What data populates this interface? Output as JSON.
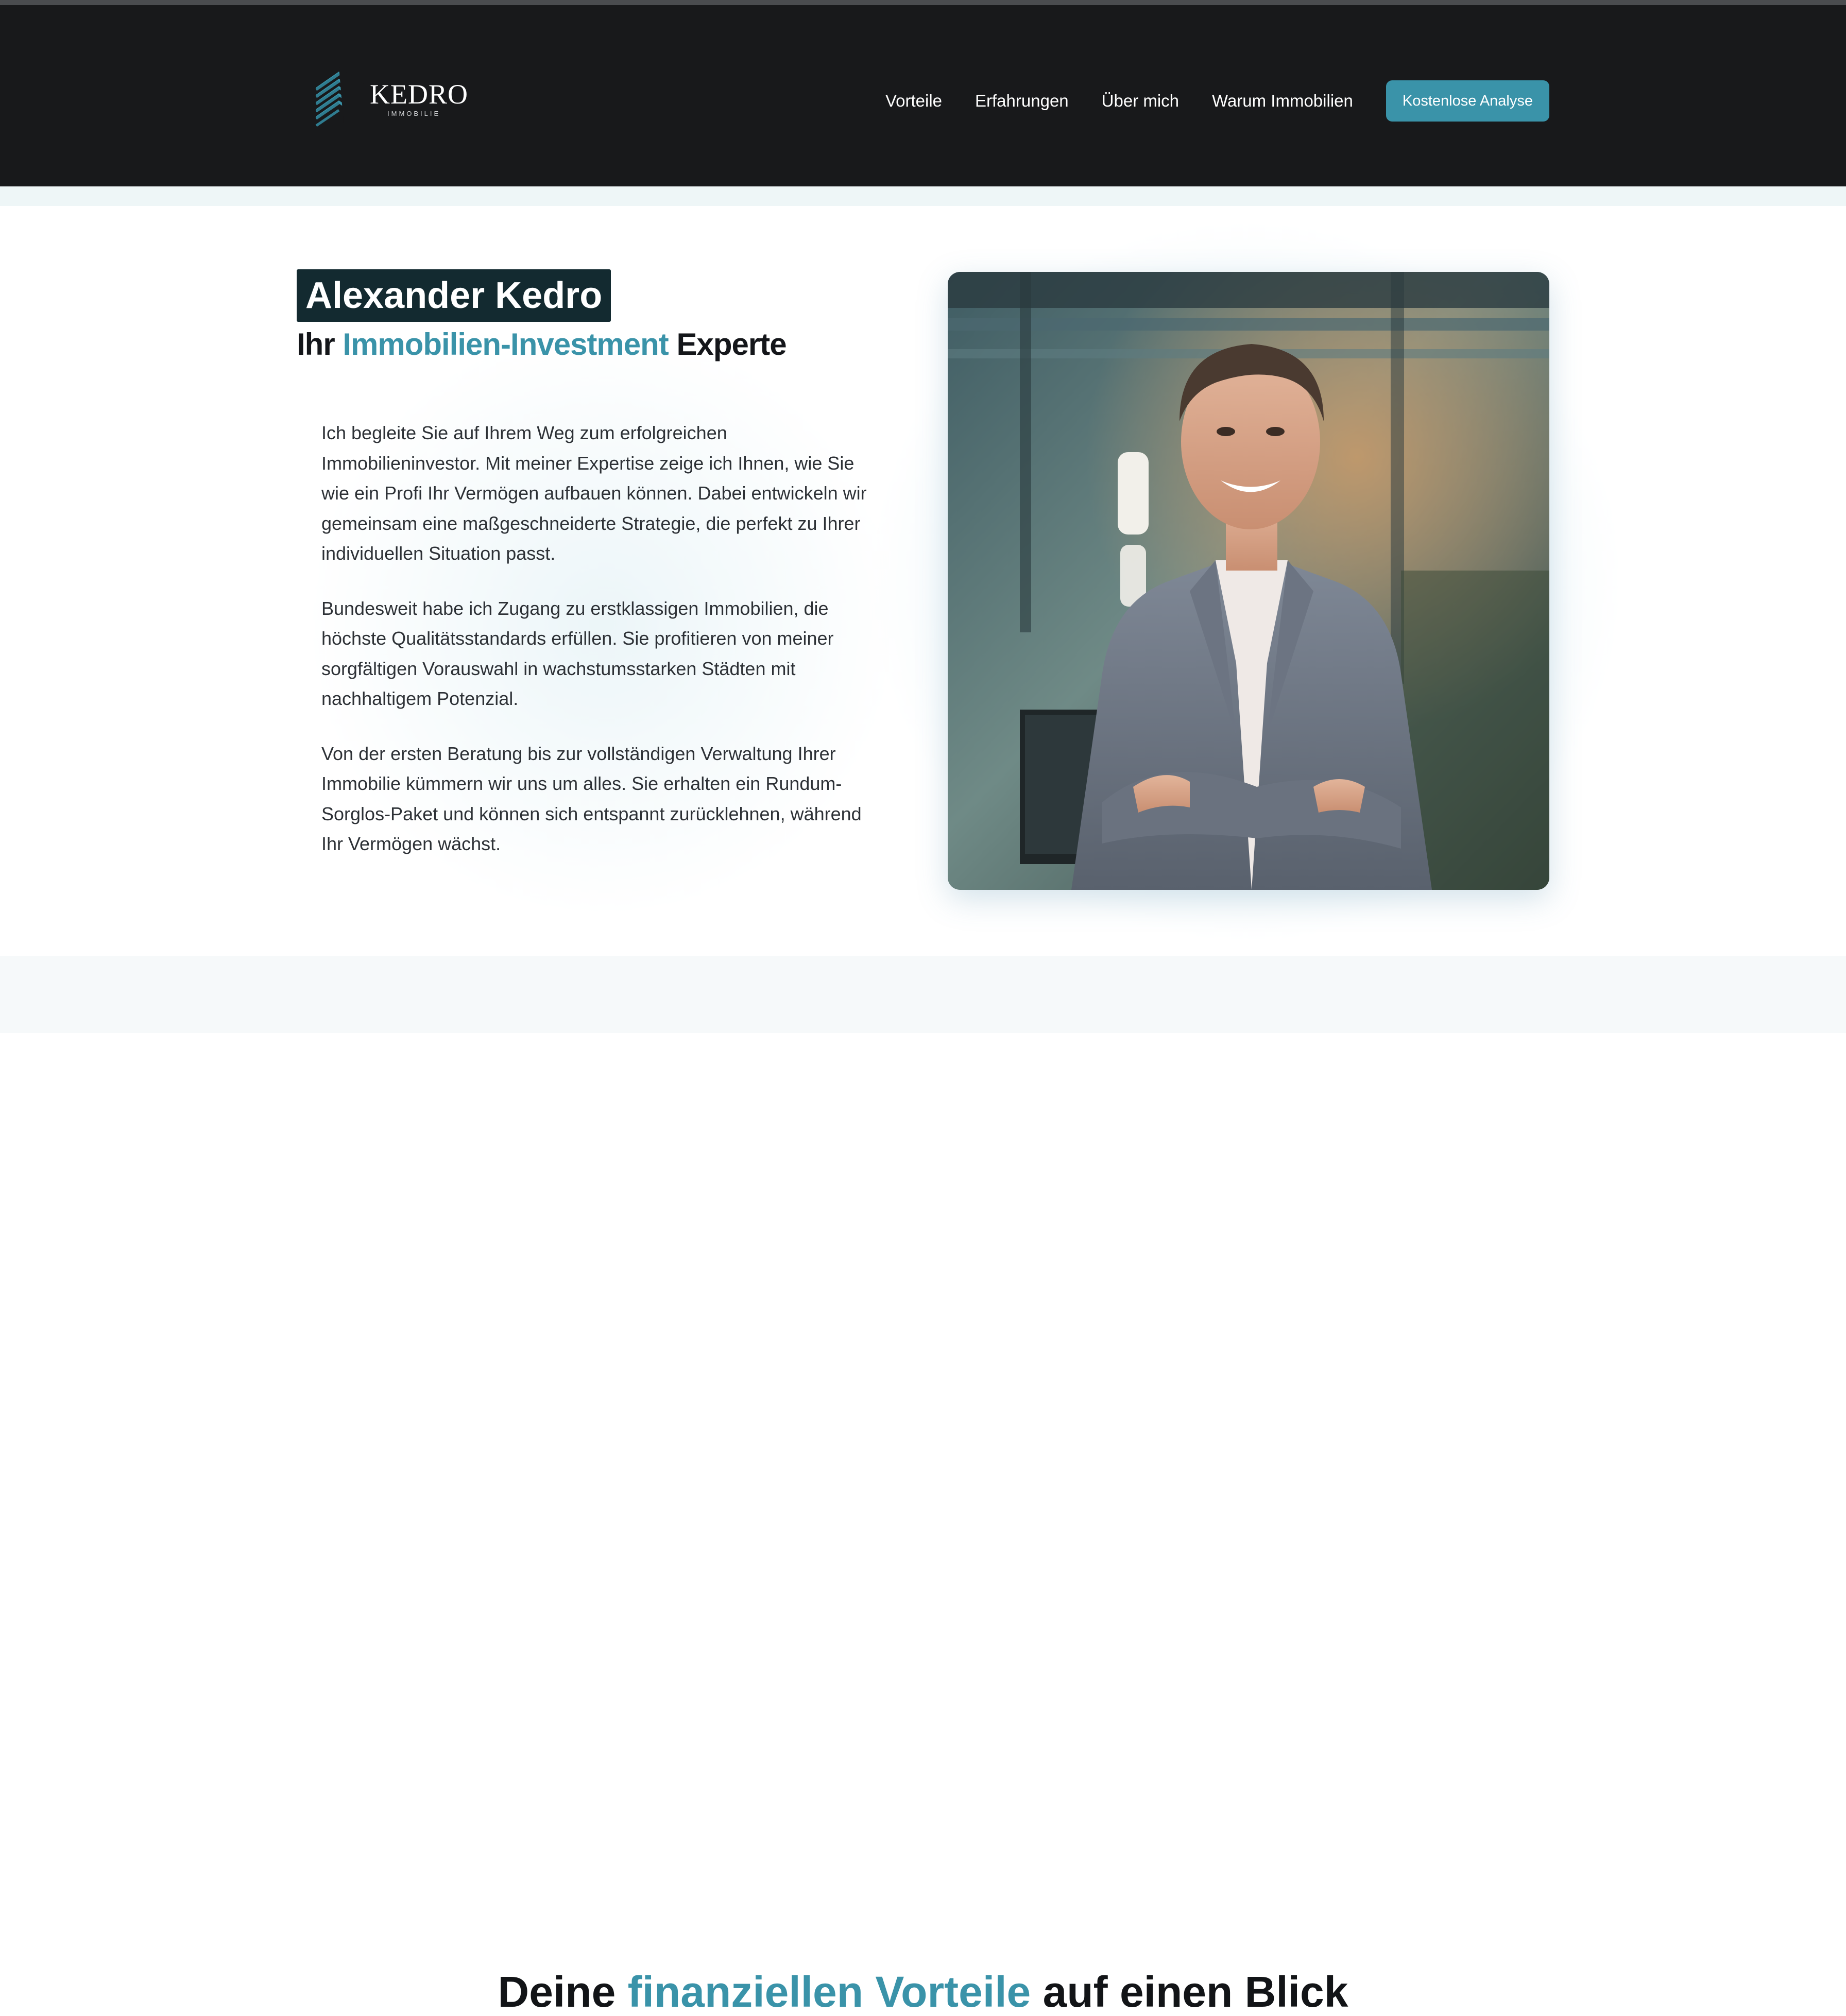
{
  "header": {
    "logo_text": "KEDRO",
    "logo_sub": "IMMOBILIE",
    "nav": [
      "Vorteile",
      "Erfahrungen",
      "Über mich",
      "Warum Immobilien"
    ],
    "cta_label": "Kostenlose Analyse"
  },
  "hero": {
    "name": "Alexander Kedro",
    "subtitle_prefix": "Ihr ",
    "subtitle_accent": "Immobilien-Investment",
    "subtitle_suffix": " Experte",
    "paragraphs": [
      "Ich begleite Sie auf Ihrem Weg zum erfolgreichen Immobilieninvestor. Mit meiner Expertise zeige ich Ihnen, wie Sie wie ein Profi Ihr Vermögen aufbauen können. Dabei entwickeln wir gemeinsam eine maßgeschneiderte Strategie, die perfekt zu Ihrer individuellen Situation passt.",
      "Bundesweit habe ich Zugang zu erstklassigen Immobilien, die höchste Qualitätsstandards erfüllen. Sie profitieren von meiner sorgfältigen Vorauswahl in wachstumsstarken Städten mit nachhaltigem Potenzial.",
      "Von der ersten Beratung bis zur vollständigen Verwaltung Ihrer Immobilie kümmern wir uns um alles. Sie erhalten ein Rundum-Sorglos-Paket und können sich entspannt zurücklehnen, während Ihr Vermögen wächst."
    ]
  },
  "next_section": {
    "heading_prefix": "Deine ",
    "heading_accent": "finanziellen Vorteile",
    "heading_suffix": " auf einen Blick"
  },
  "colors": {
    "nav_bg": "#18191b",
    "accent": "#3a93a9",
    "name_bg": "#132a30"
  }
}
